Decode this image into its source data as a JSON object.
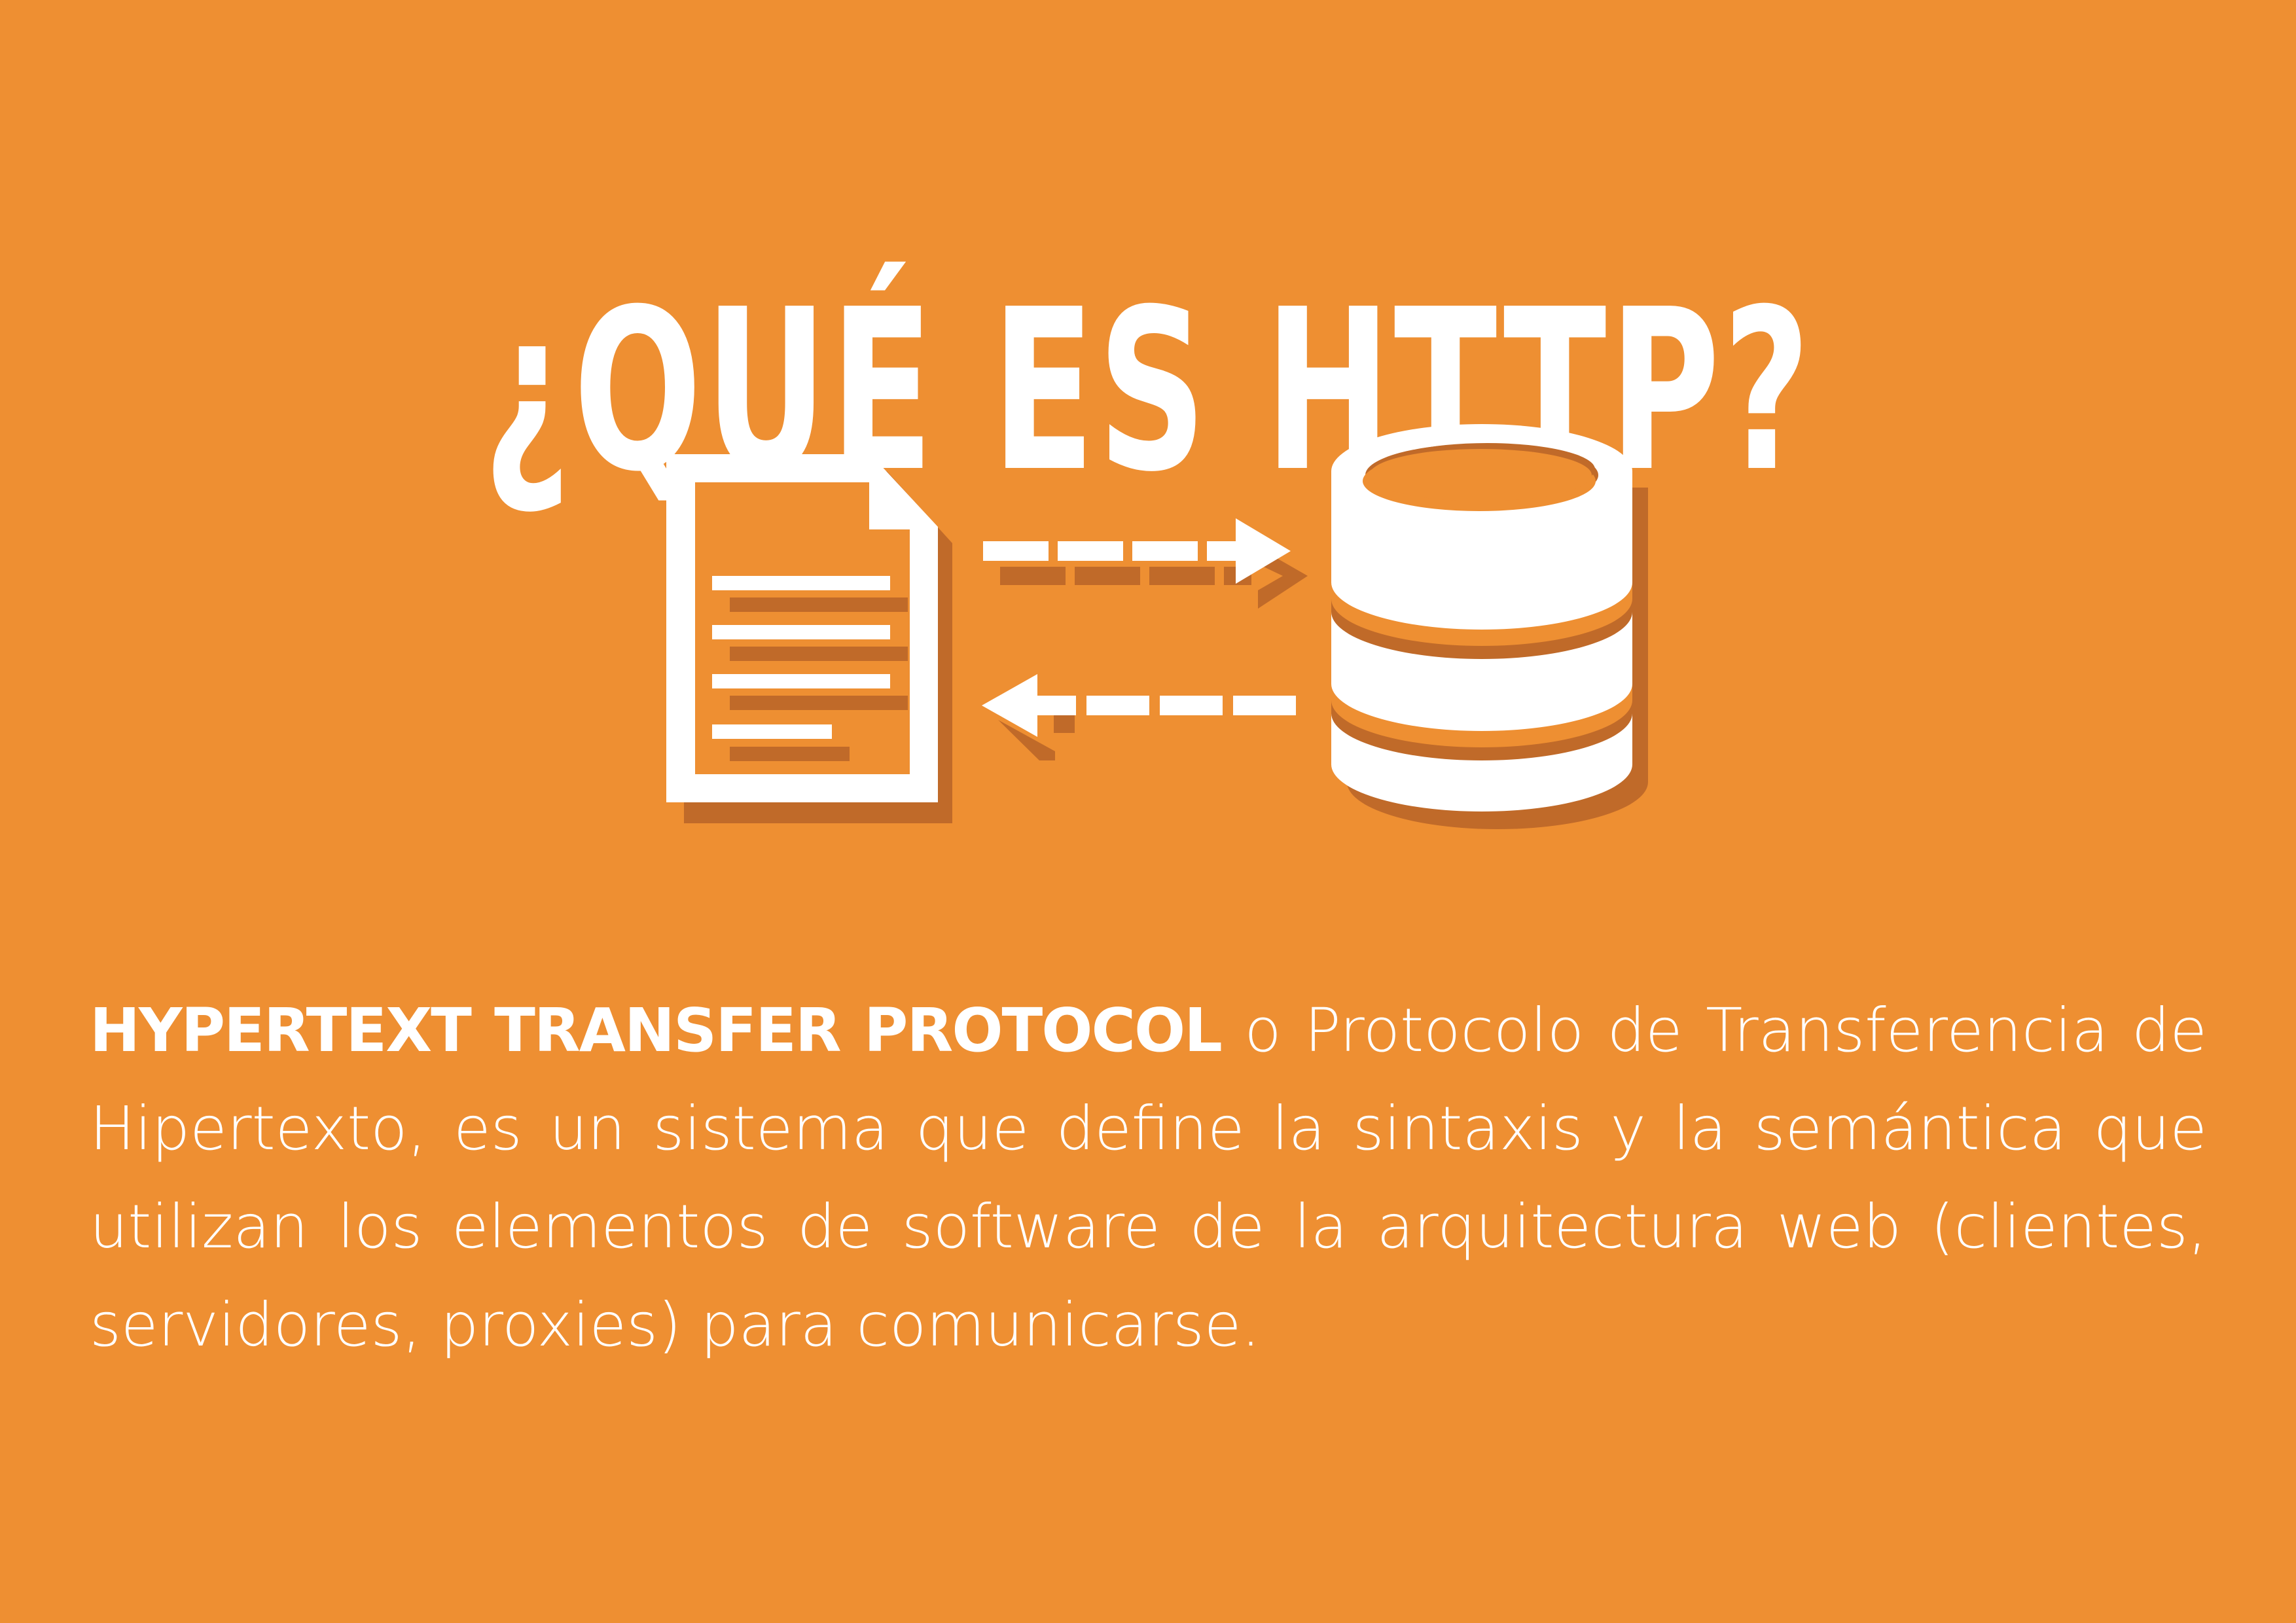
{
  "title": "¿QUÉ ES HTTP?",
  "description": {
    "lead": "HYPERTEXT TRANSFER PROTOCOL",
    "text": " o Protocolo de Transferencia de Hipertexto, es un sistema que define la sintaxis y la semántica que utilizan los elementos de software de la arquitectura web (clientes, servidores, proxies) para comunicarse."
  },
  "colors": {
    "background": "#ee8f32",
    "foreground": "#ffffff",
    "shadow": "#c06a29"
  },
  "icons": [
    "document-icon",
    "arrow-right-icon",
    "arrow-left-icon",
    "database-icon"
  ]
}
